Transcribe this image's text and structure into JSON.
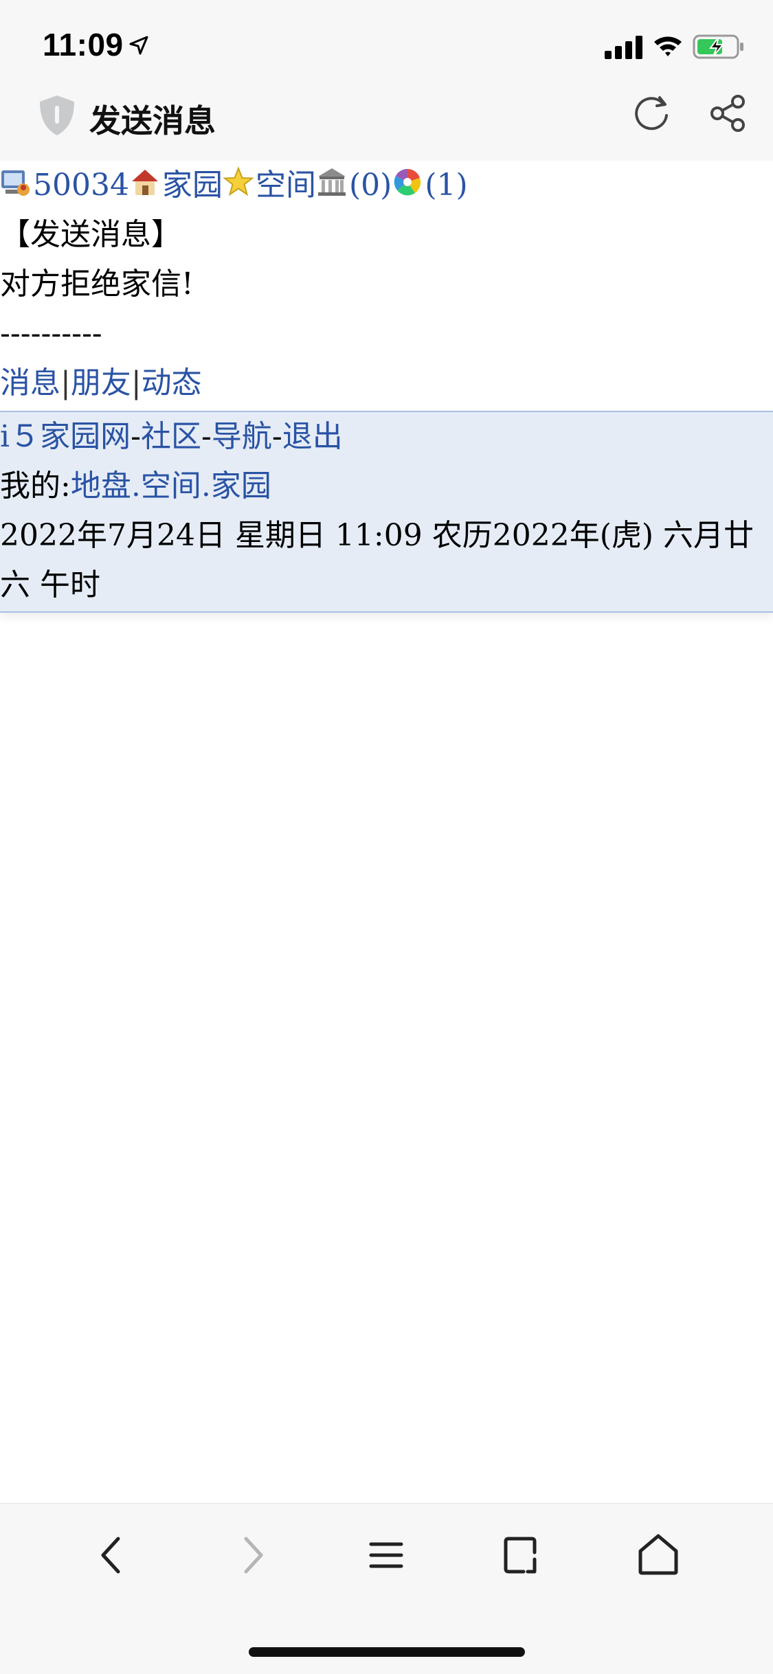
{
  "status_bar": {
    "time": "11:09",
    "icons": [
      "location-arrow-icon",
      "cellular-signal-icon",
      "wifi-icon",
      "battery-charging-icon"
    ],
    "battery_color": "#34c759"
  },
  "browser": {
    "page_title": "发送消息",
    "icons": [
      "shield-icon",
      "reload-icon",
      "share-icon"
    ]
  },
  "top_nav": {
    "user_id": "50034",
    "home_link": "家园",
    "space_link": "空间",
    "bank_count": "(0)",
    "photo_count": "(1)"
  },
  "message": {
    "header": "【发送消息】",
    "text": "对方拒绝家信!",
    "divider": "----------"
  },
  "links": {
    "messages": "消息",
    "friends": "朋友",
    "feed": "动态",
    "sep": "|"
  },
  "footer": {
    "site": "i５家园网",
    "community": "社区",
    "navigation": "导航",
    "logout": "退出",
    "dash": "-",
    "mine_label": "我的:",
    "territory": "地盘",
    "space": "空间",
    "home": "家园",
    "dot": ".",
    "datetime": "2022年7月24日  星期日  11:09  农历2022年(虎)  六月廿六  午时"
  },
  "toolbar": {
    "buttons": [
      "back-icon",
      "forward-icon",
      "menu-icon",
      "tabs-icon",
      "home-icon"
    ]
  },
  "colors": {
    "link": "#2a53a4",
    "footer_bg": "#e5ecf6",
    "chrome_bg": "#f7f7f7"
  }
}
